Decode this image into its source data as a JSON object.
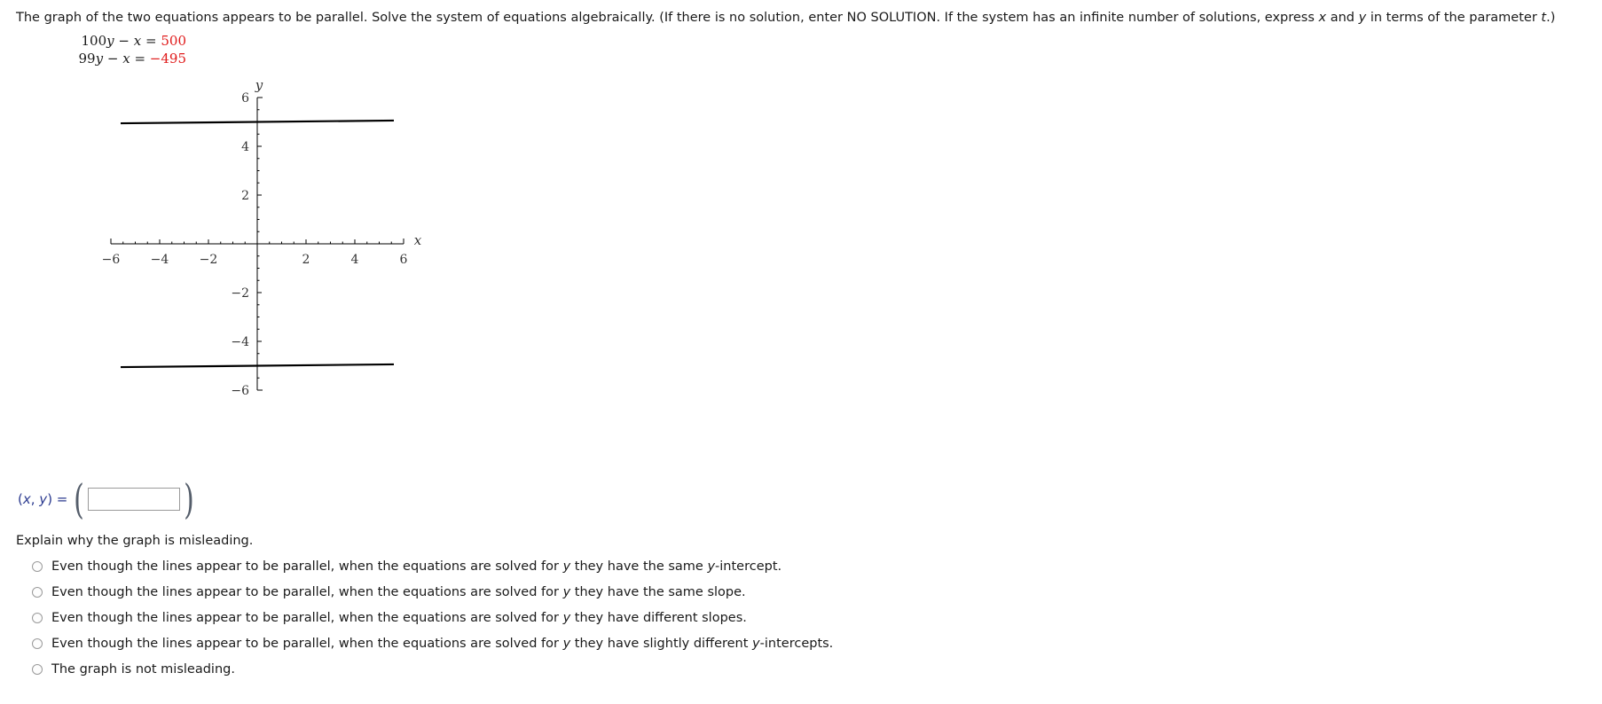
{
  "prompt": {
    "text_part1": "The graph of the two equations appears to be parallel. Solve the system of equations algebraically. (If there is no solution, enter NO SOLUTION. If the system has an infinite number of solutions, express ",
    "var_x": "x",
    "text_part2": " and ",
    "var_y": "y",
    "text_part3": " in terms of the parameter ",
    "var_t": "t",
    "text_part4": ".)"
  },
  "equations": [
    {
      "coefficient": "100",
      "var1": "y",
      "operator": "−",
      "var2": "x",
      "equals": "=",
      "value": "500"
    },
    {
      "coefficient": "99",
      "var1": "y",
      "operator": "−",
      "var2": "x",
      "equals": "=",
      "value": "−495"
    }
  ],
  "chart_data": {
    "type": "line",
    "title": "",
    "xlabel": "x",
    "ylabel": "y",
    "xlim": [
      -6,
      6
    ],
    "ylim": [
      -6,
      6
    ],
    "grid": false,
    "legend": "none",
    "x_ticks": [
      -6,
      -4,
      -2,
      2,
      4,
      6
    ],
    "x_tick_labels": [
      "−6",
      "−4",
      "−2",
      "2",
      "4",
      "6"
    ],
    "y_ticks": [
      6,
      4,
      2,
      -2,
      -4,
      -6
    ],
    "y_tick_labels": [
      "6",
      "4",
      "2",
      "−2",
      "−4",
      "−6"
    ],
    "minor_tick_step": 0.5,
    "series": [
      {
        "name": "100y − x = 500",
        "equation_y": "y = 5 + x/100",
        "x": [
          -5.6,
          5.6
        ],
        "values": [
          4.944,
          5.056
        ],
        "color": "#000000"
      },
      {
        "name": "99y − x = −495",
        "equation_y": "y = −5 + x/99",
        "x": [
          -5.6,
          5.6
        ],
        "values": [
          -5.057,
          -4.943
        ],
        "color": "#000000"
      }
    ]
  },
  "answer": {
    "label_open": "(",
    "label_x": "x",
    "label_comma": ", ",
    "label_y": "y",
    "label_close": ") =",
    "paren_left": "(",
    "paren_right": ")",
    "value": "",
    "placeholder": ""
  },
  "explain": {
    "title": "Explain why the graph is misleading.",
    "options": [
      {
        "pre": "Even though the lines appear to be parallel, when the equations are solved for ",
        "var": "y",
        "mid": " they have the same ",
        "var2": "y",
        "post": "-intercept."
      },
      {
        "pre": "Even though the lines appear to be parallel, when the equations are solved for ",
        "var": "y",
        "mid": " they have the same slope.",
        "var2": "",
        "post": ""
      },
      {
        "pre": "Even though the lines appear to be parallel, when the equations are solved for ",
        "var": "y",
        "mid": " they have different slopes.",
        "var2": "",
        "post": ""
      },
      {
        "pre": "Even though the lines appear to be parallel, when the equations are solved for ",
        "var": "y",
        "mid": " they have slightly different ",
        "var2": "y",
        "post": "-intercepts."
      },
      {
        "pre": "The graph is not misleading.",
        "var": "",
        "mid": "",
        "var2": "",
        "post": ""
      }
    ]
  }
}
